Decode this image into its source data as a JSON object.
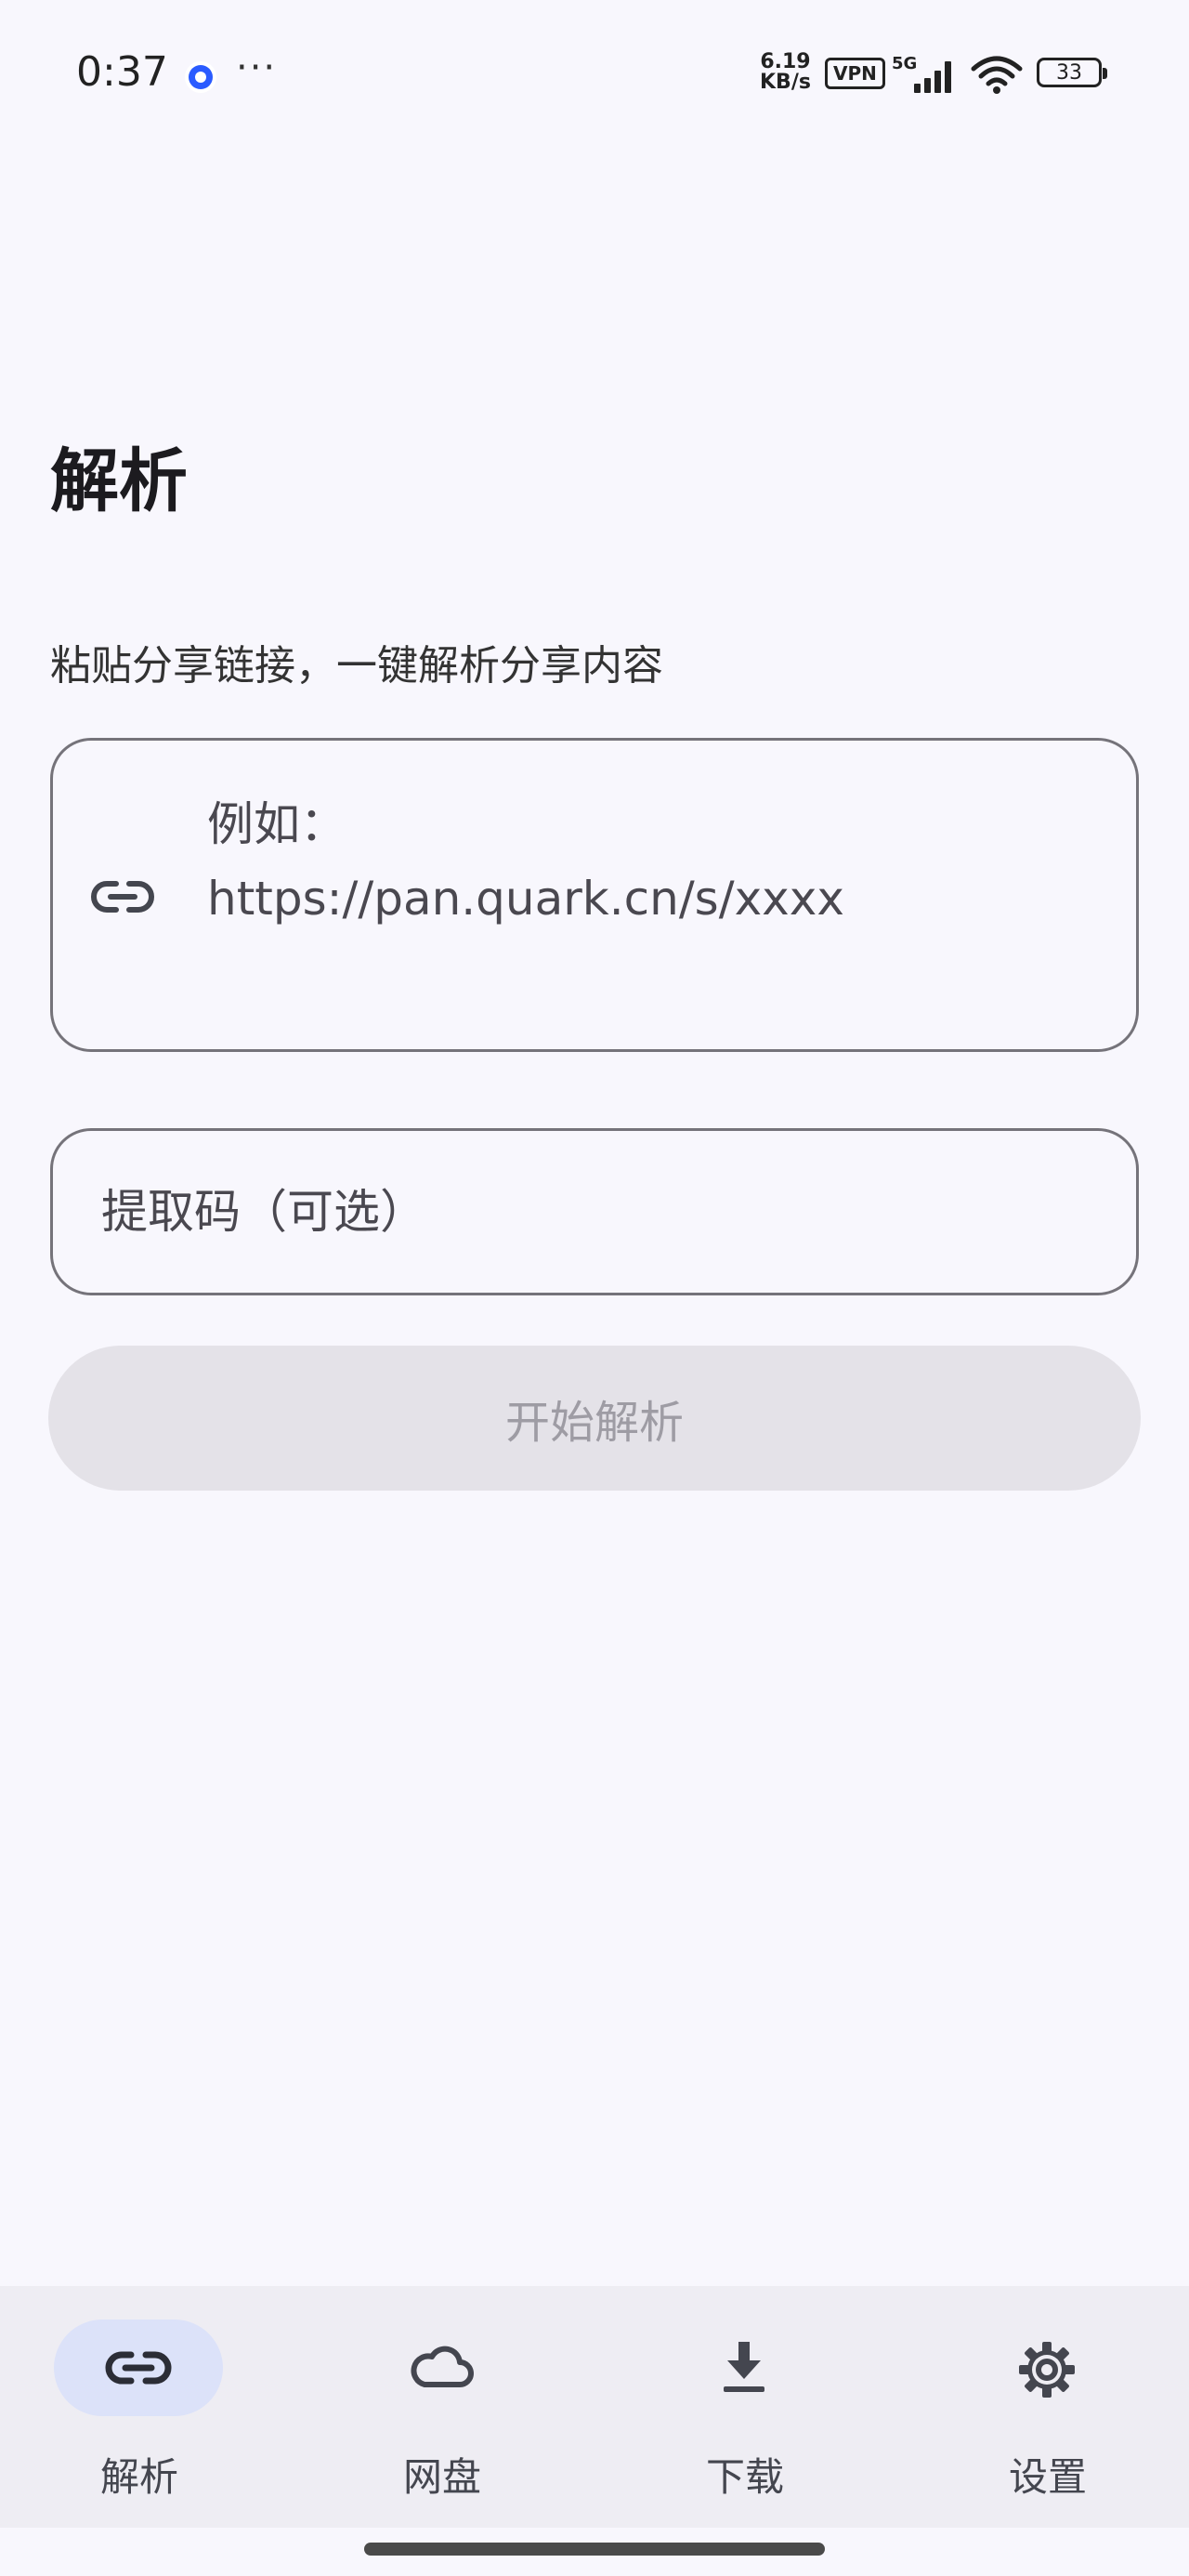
{
  "status_bar": {
    "time": "0:37",
    "more": "···",
    "net_speed_value": "6.19",
    "net_speed_unit": "KB/s",
    "vpn": "VPN",
    "network": "5G",
    "battery": "33"
  },
  "page": {
    "title": "解析",
    "subtitle": "粘贴分享链接，一键解析分享内容"
  },
  "link_input": {
    "icon": "link-icon",
    "placeholder": "例如：\nhttps://pan.quark.cn/s/xxxx"
  },
  "code_input": {
    "placeholder": "提取码（可选）",
    "value": ""
  },
  "parse_button": {
    "label": "开始解析"
  },
  "bottom_nav": {
    "items": [
      {
        "label": "解析",
        "icon": "link-icon",
        "active": true
      },
      {
        "label": "网盘",
        "icon": "cloud-icon",
        "active": false
      },
      {
        "label": "下载",
        "icon": "download-icon",
        "active": false
      },
      {
        "label": "设置",
        "icon": "gear-icon",
        "active": false
      }
    ]
  },
  "colors": {
    "background": "#f8f7fd",
    "nav_background": "#eeedf3",
    "active_pill": "#dce2f9",
    "disabled_button": "#e4e2e8",
    "outline": "#75737a"
  }
}
